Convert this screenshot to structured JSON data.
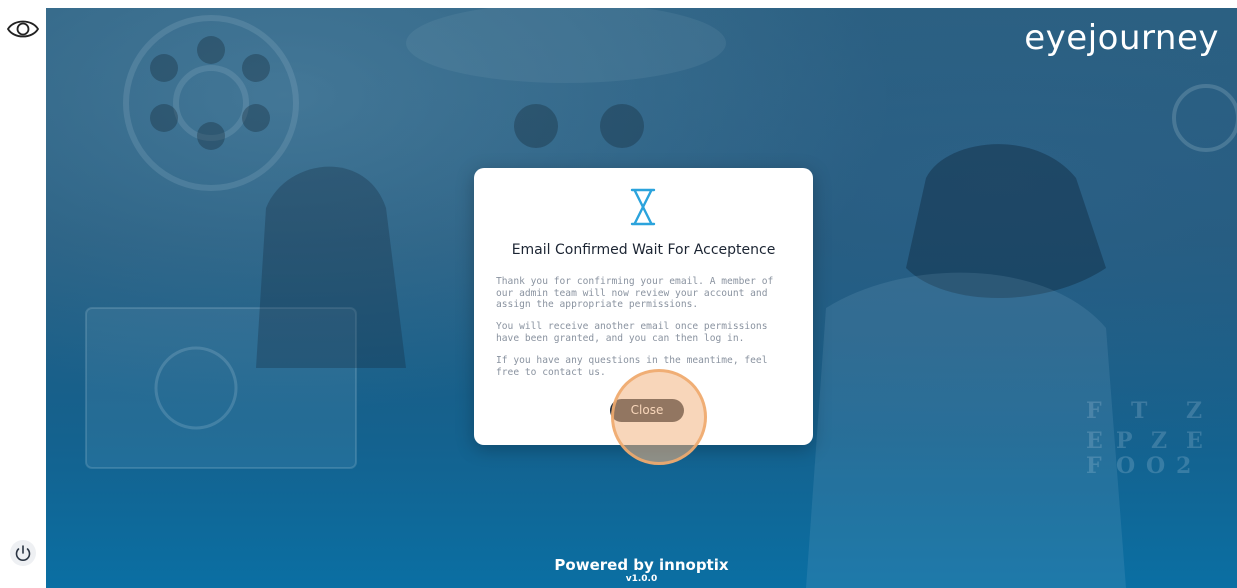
{
  "app": {
    "brand": "eyejourney"
  },
  "sidebar": {
    "top_icon": "eye-icon",
    "bottom_icon": "power-icon"
  },
  "modal": {
    "icon": "hourglass-icon",
    "title": "Email Confirmed Wait For Acceptence",
    "paragraphs": [
      "Thank you for confirming your email. A member of our admin team will now review your account and assign the appropriate permissions.",
      "You will receive another email once permissions have been granted, and you can then log in.",
      "If you have any questions in the meantime, feel free to contact us."
    ],
    "close_label": "Close"
  },
  "footer": {
    "powered_by": "Powered by innoptix",
    "version": "v1.0.0"
  },
  "colors": {
    "accent": "#2ba3dc",
    "button": "#1d2b3a",
    "background": "#1c6a98"
  }
}
